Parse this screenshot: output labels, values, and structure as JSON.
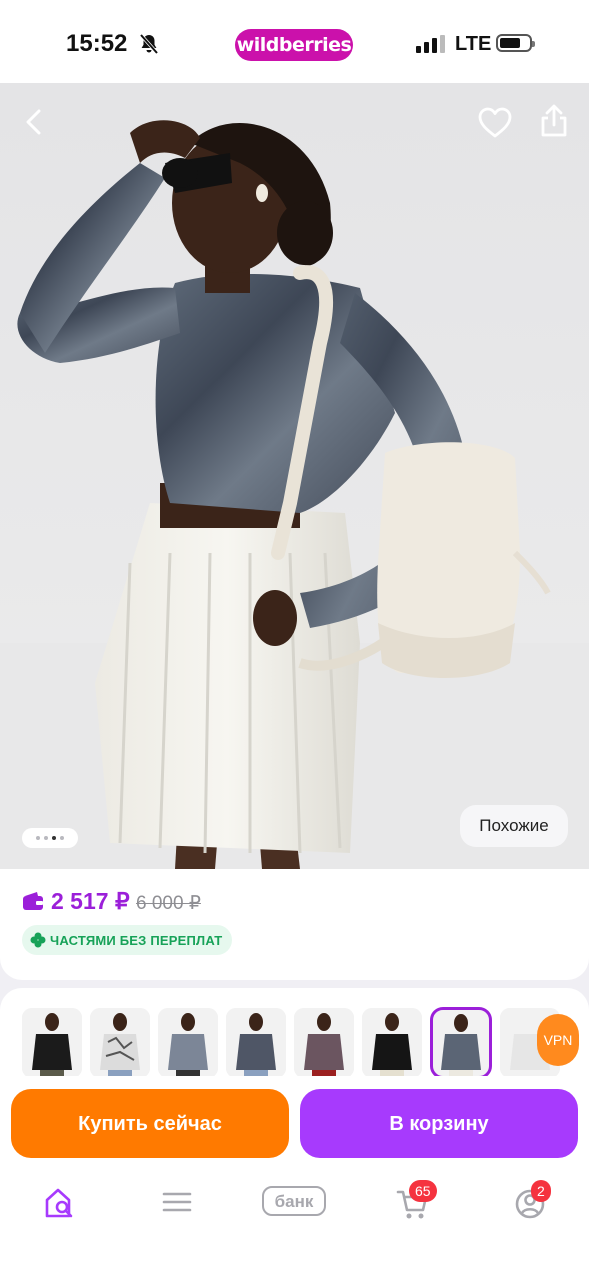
{
  "status_bar": {
    "time": "15:52",
    "brand": "wildberries",
    "network": "LTE"
  },
  "product": {
    "similar_label": "Похожие",
    "gallery": {
      "total": 4,
      "active_index": 2
    }
  },
  "price": {
    "current": "2 517 ₽",
    "old": "6 000 ₽",
    "installment": "ЧАСТЯМИ БЕЗ ПЕРЕПЛАТ"
  },
  "variants": {
    "count": 8,
    "selected_index": 6
  },
  "vpn_label": "VPN",
  "actions": {
    "buy_now": "Купить сейчас",
    "to_cart": "В корзину"
  },
  "tabbar": {
    "bank_label": "банк",
    "cart_badge": "65",
    "profile_badge": "2"
  },
  "colors": {
    "brand": "#cb11ab",
    "price": "#9b1fd9",
    "buy": "#ff7a00",
    "cart": "#a73afd",
    "badge": "#f5333f",
    "installment": "#17a258"
  }
}
